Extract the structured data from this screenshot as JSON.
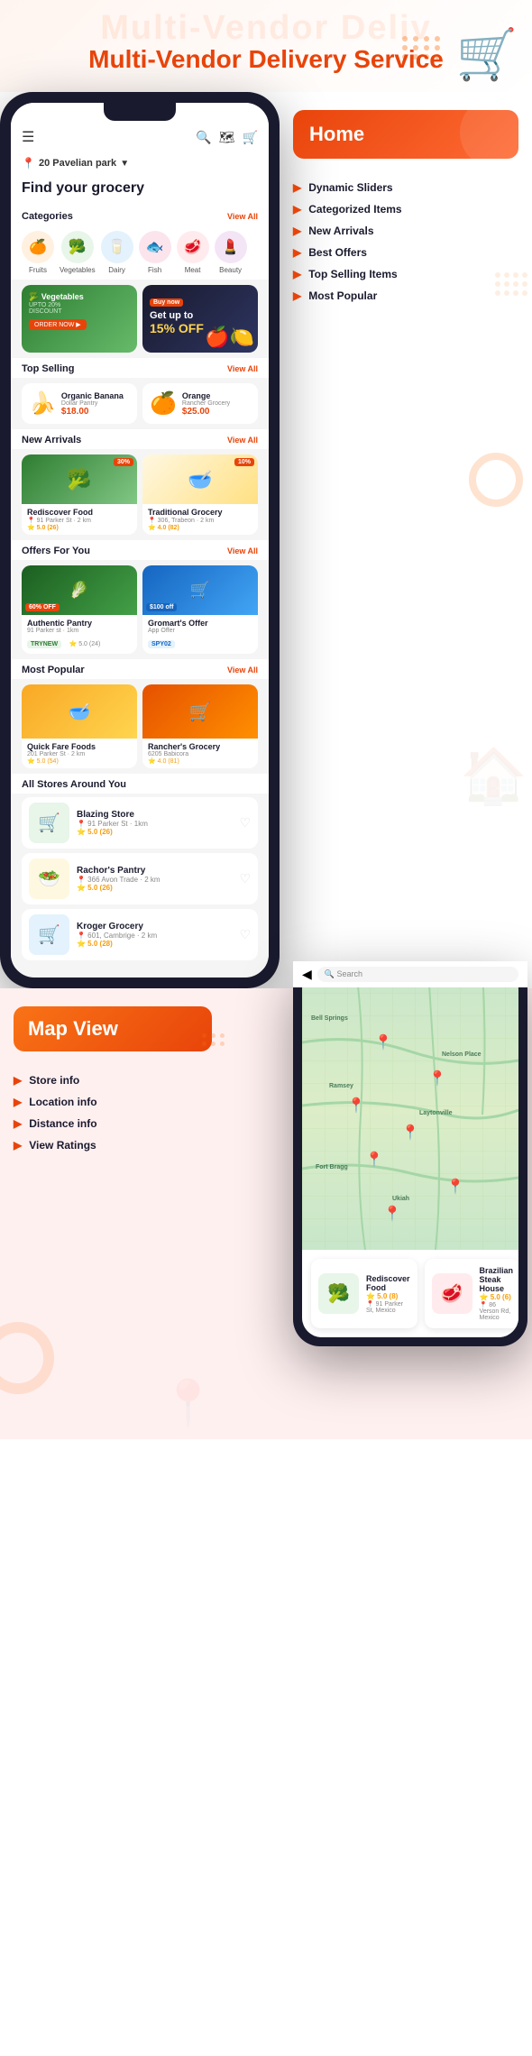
{
  "hero": {
    "bg_text": "Multi-Vendor Deliv",
    "title": "Multi-Vendor Delivery Service"
  },
  "app": {
    "location": "20 Pavelian park",
    "find_title": "Find your grocery",
    "categories_label": "Categories",
    "view_all": "View All",
    "categories": [
      {
        "name": "Fruits",
        "emoji": "🍊",
        "bg": "cat-fruits"
      },
      {
        "name": "Vegetables",
        "emoji": "🥦",
        "bg": "cat-veg"
      },
      {
        "name": "Dairy",
        "emoji": "🥛",
        "bg": "cat-dairy"
      },
      {
        "name": "Fish",
        "emoji": "🐟",
        "bg": "cat-fish"
      },
      {
        "name": "Meat",
        "emoji": "🥩",
        "bg": "cat-meat"
      },
      {
        "name": "Beauty",
        "emoji": "💄",
        "bg": "cat-beauty"
      }
    ],
    "banner_green": {
      "title": "Vegetables",
      "sub": "UPTO 20% DISCOUNT",
      "btn": "ORDER NOW >"
    },
    "banner_dark": {
      "tag": "Buy now",
      "line1": "Get up to",
      "line2": "15% OFF",
      "sub": "Buy now"
    },
    "top_selling_label": "Top Selling",
    "products": [
      {
        "name": "Organic Banana",
        "store": "Dollar Pantry",
        "price": "$18.00",
        "emoji": "🍌"
      },
      {
        "name": "Orange",
        "store": "Rancher Grocery",
        "price": "$25.00",
        "emoji": "🍊"
      }
    ],
    "new_arrivals_label": "New Arrivals",
    "arrivals": [
      {
        "name": "Rediscover Food",
        "loc": "91 Parker St",
        "dist": "2 km",
        "rating": "5.0 (26)",
        "emoji": "🥦",
        "bg": "arrival-img-green",
        "discount": "30%"
      },
      {
        "name": "Traditional Grocery",
        "loc": "306, Trabeon",
        "dist": "2 km",
        "rating": "4.0 (82)",
        "emoji": "🥣",
        "bg": "arrival-img-light",
        "discount": "10%"
      }
    ],
    "offers_label": "Offers For You",
    "offers": [
      {
        "name": "Authentic Pantry",
        "loc": "91 Parker st",
        "dist": "1km",
        "tag": "TRYNEW",
        "rating": "5.0 (24)",
        "emoji": "🥬",
        "badge": "60% OFF",
        "bg": "offer-img-green"
      },
      {
        "name": "Gromart's Offer",
        "sub": "App Offer",
        "code": "SPY02",
        "emoji": "🛒",
        "badge": "$100 off",
        "bg": "offer-img-blue"
      }
    ],
    "most_popular_label": "Most Popular",
    "popular": [
      {
        "name": "Quick Fare Foods",
        "loc": "201 Parker St",
        "dist": "2 km",
        "rating": "5.0 (54)",
        "emoji": "🥣",
        "bg": "popular-img-yellow"
      },
      {
        "name": "Rancher's Grocery",
        "loc": "6205 Babicora",
        "rating": "4.0 (81)",
        "emoji": "🛒",
        "bg": "popular-img-orange"
      }
    ],
    "stores_label": "All Stores Around You",
    "stores": [
      {
        "name": "Blazing Store",
        "loc": "91 Parker St",
        "dist": "1km",
        "rating": "5.0 (26)",
        "emoji": "🛒",
        "bg": "store-img-1"
      },
      {
        "name": "Rachor's Pantry",
        "loc": "366 Avon Trade",
        "dist": "2 km",
        "rating": "5.0 (26)",
        "emoji": "🥗",
        "bg": "store-img-2"
      },
      {
        "name": "Kroger Grocery",
        "loc": "601, Cambrige",
        "dist": "2 km",
        "rating": "5.0 (28)",
        "emoji": "🛒",
        "bg": "store-img-3"
      }
    ]
  },
  "home_section": {
    "title": "Home",
    "features": [
      "Dynamic Sliders",
      "Categorized Items",
      "New Arrivals",
      "Best Offers",
      "Top Selling Items",
      "Most Popular"
    ]
  },
  "map_section": {
    "title": "Map View",
    "features": [
      "Store info",
      "Location info",
      "Distance info",
      "View Ratings"
    ],
    "map_search_placeholder": "Search",
    "stores": [
      {
        "name": "Rediscover Food",
        "rating": "5.0 (8)",
        "loc": "91 Parker St, Mexico",
        "emoji": "🥦",
        "bg": "store-map-img-1"
      },
      {
        "name": "Brazilian Steak House",
        "rating": "5.0 (6)",
        "loc": "86 Verson Rd, Mexico",
        "emoji": "🥩",
        "bg": "store-map-img-2"
      }
    ]
  }
}
